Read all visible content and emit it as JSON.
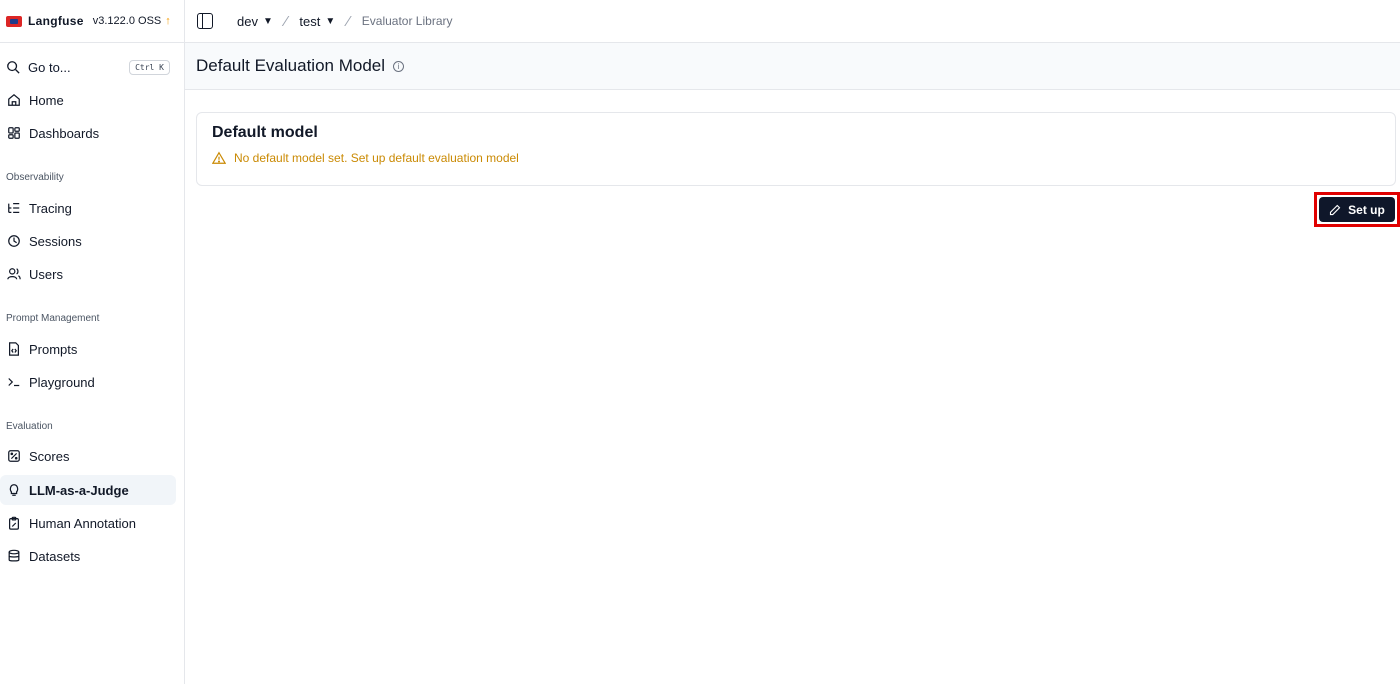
{
  "brand": {
    "name": "Langfuse",
    "version": "v3.122.0 OSS",
    "update_arrow": "↑"
  },
  "sidebar": {
    "goto_label": "Go to...",
    "goto_shortcut": "Ctrl K",
    "items": {
      "home": "Home",
      "dashboards": "Dashboards",
      "tracing": "Tracing",
      "sessions": "Sessions",
      "users": "Users",
      "prompts": "Prompts",
      "playground": "Playground",
      "scores": "Scores",
      "llm_judge": "LLM-as-a-Judge",
      "human_annotation": "Human Annotation",
      "datasets": "Datasets"
    },
    "sections": {
      "observability": "Observability",
      "prompt_management": "Prompt Management",
      "evaluation": "Evaluation"
    }
  },
  "breadcrumb": {
    "org": "dev",
    "project": "test",
    "page": "Evaluator Library"
  },
  "page": {
    "title": "Default Evaluation Model"
  },
  "card": {
    "title": "Default model",
    "warning": "No default model set. Set up default evaluation model"
  },
  "actions": {
    "setup_label": "Set up"
  },
  "colors": {
    "accent": "#0f172a",
    "warning": "#ca8a04",
    "highlight": "#e00000"
  }
}
